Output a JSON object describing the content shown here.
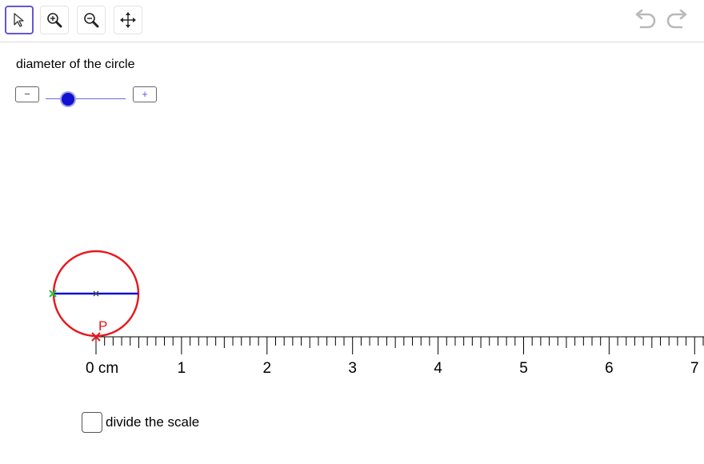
{
  "toolbar": {
    "tools": [
      {
        "name": "move-tool",
        "icon": "cursor-arrow-icon",
        "selected": true
      },
      {
        "name": "zoom-in-tool",
        "icon": "zoom-in-icon",
        "selected": false
      },
      {
        "name": "zoom-out-tool",
        "icon": "zoom-out-icon",
        "selected": false
      },
      {
        "name": "move-view-tool",
        "icon": "move-arrows-icon",
        "selected": false
      }
    ],
    "undo_icon": "undo-icon",
    "redo_icon": "redo-icon"
  },
  "slider": {
    "caption": "diameter of the circle",
    "minus_label": "−",
    "plus_label": "+",
    "value_fraction": 0.28
  },
  "ruler": {
    "unit": "cm",
    "labels": [
      "0 cm",
      "1",
      "2",
      "3",
      "4",
      "5",
      "6",
      "7"
    ]
  },
  "point_label": "P",
  "checkbox": {
    "label": "divide the scale",
    "checked": false
  },
  "colors": {
    "accent": "#6557d2",
    "circle": "#e8161d",
    "diameter": "#1010d0",
    "endpoint": "#22c43c",
    "point": "#e8161d"
  }
}
